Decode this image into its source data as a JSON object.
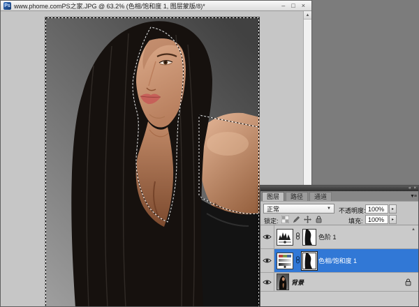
{
  "window": {
    "app_icon_label": "Ps",
    "title": "www.phome.comPS之家.JPG @ 63.2% (色相/饱和度 1, 图层蒙版/8)*",
    "buttons": {
      "minimize": "–",
      "restore": "□",
      "close": "×"
    },
    "scrollbar_up_glyph": "▲"
  },
  "panel": {
    "header": {
      "collapse_glyph": "«",
      "close_glyph": "×",
      "menu_glyph": "▼≡"
    },
    "tabs": [
      {
        "label": "图层",
        "active": true
      },
      {
        "label": "路径",
        "active": false
      },
      {
        "label": "通道",
        "active": false
      }
    ],
    "blend_mode": {
      "value": "正常",
      "arrow": "▼"
    },
    "opacity": {
      "label": "不透明度:",
      "value": "100%",
      "spin": "▸"
    },
    "lock": {
      "label": "锁定:"
    },
    "fill": {
      "label": "填充:",
      "value": "100%",
      "spin": "▸"
    },
    "layers": [
      {
        "name": "色阶 1",
        "type": "levels-adjustment",
        "selected": false
      },
      {
        "name": "色相/饱和度 1",
        "type": "hue-saturation-adjustment",
        "selected": true
      },
      {
        "name": "背景",
        "type": "background-image",
        "selected": false,
        "locked": true
      }
    ],
    "list_scroll_up_glyph": "▲"
  },
  "colors": {
    "app_background": "#7c7c7c",
    "canvas_background": "#c6c6c6",
    "panel_background": "#c5c5c5",
    "selected_layer_blue": "#3178d6"
  }
}
